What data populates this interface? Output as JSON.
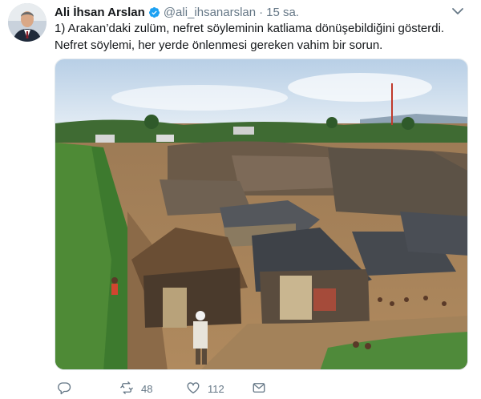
{
  "tweet": {
    "author_name": "Ali İhsan Arslan",
    "author_handle": "@ali_ihsanarslan",
    "separator": "·",
    "timestamp": "15 sa.",
    "verified": true,
    "text": "1) Arakan’daki zulüm, nefret söyleminin katliama dönüşebildiğini gösterdi. Nefret söylemi, her yerde önlenmesi gereken vahim bir sorun."
  },
  "actions": {
    "retweet_count": "48",
    "like_count": "112"
  },
  "icons": {
    "verified": "verified-badge-icon",
    "caret": "chevron-down-icon",
    "reply": "reply-icon",
    "retweet": "retweet-icon",
    "like": "heart-icon",
    "dm": "envelope-icon"
  },
  "colors": {
    "accent": "#1da1f2",
    "secondary_text": "#657786",
    "primary_text": "#14171a"
  }
}
